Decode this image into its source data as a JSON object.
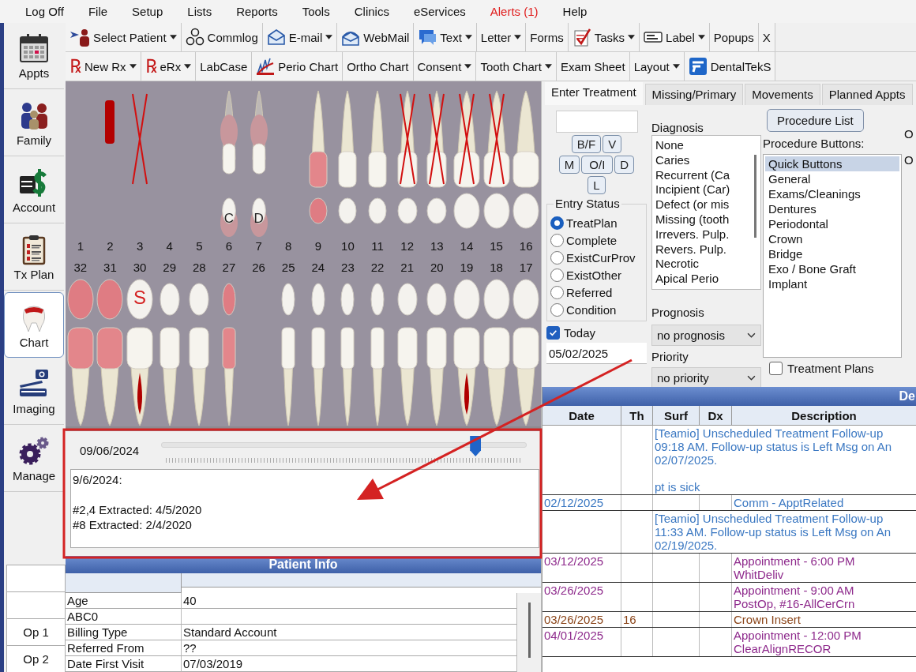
{
  "menu": [
    {
      "label": "Log Off",
      "alert": false
    },
    {
      "label": "File",
      "alert": false
    },
    {
      "label": "Setup",
      "alert": false
    },
    {
      "label": "Lists",
      "alert": false
    },
    {
      "label": "Reports",
      "alert": false
    },
    {
      "label": "Tools",
      "alert": false
    },
    {
      "label": "Clinics",
      "alert": false
    },
    {
      "label": "eServices",
      "alert": false
    },
    {
      "label": "Alerts (1)",
      "alert": true
    },
    {
      "label": "Help",
      "alert": false
    }
  ],
  "sidebar": {
    "items": [
      {
        "label": "Appts",
        "selected": false
      },
      {
        "label": "Family",
        "selected": false
      },
      {
        "label": "Account",
        "selected": false
      },
      {
        "label": "Tx Plan",
        "selected": false
      },
      {
        "label": "Chart",
        "selected": true
      },
      {
        "label": "Imaging",
        "selected": false
      },
      {
        "label": "Manage",
        "selected": false
      }
    ]
  },
  "op_list": [
    "Op 1",
    "Op 2"
  ],
  "toolbar_1": {
    "buttons": [
      {
        "label": "Select Patient",
        "kind": "patient",
        "dropdown": true
      },
      {
        "label": "Commlog",
        "kind": "commlog",
        "dropdown": false
      },
      {
        "label": "E-mail",
        "kind": "email",
        "dropdown": true
      },
      {
        "label": "WebMail",
        "kind": "webmail",
        "dropdown": false
      },
      {
        "label": "Text",
        "kind": "text",
        "dropdown": true
      },
      {
        "label": "Letter",
        "kind": "plain",
        "dropdown": true
      },
      {
        "label": "Forms",
        "kind": "plain",
        "dropdown": false
      },
      {
        "label": "Tasks",
        "kind": "tasks",
        "dropdown": true
      },
      {
        "label": "Label",
        "kind": "label",
        "dropdown": true
      },
      {
        "label": "Popups",
        "kind": "plain",
        "dropdown": false
      },
      {
        "label": "X",
        "kind": "plain",
        "dropdown": false
      }
    ]
  },
  "toolbar_2": {
    "buttons": [
      {
        "label": "New Rx",
        "kind": "rx",
        "icon_text": "℞",
        "dropdown": true
      },
      {
        "label": "eRx",
        "kind": "rx",
        "icon_text": "℞",
        "dropdown": true
      },
      {
        "label": "LabCase",
        "kind": "plain",
        "dropdown": false
      },
      {
        "label": "Perio Chart",
        "kind": "perio",
        "dropdown": false
      },
      {
        "label": "Ortho Chart",
        "kind": "plain",
        "dropdown": false
      },
      {
        "label": "Consent",
        "kind": "plain",
        "dropdown": true
      },
      {
        "label": "Tooth Chart",
        "kind": "plain",
        "dropdown": true
      },
      {
        "label": "Exam Sheet",
        "kind": "plain",
        "dropdown": false
      },
      {
        "label": "Layout",
        "kind": "plain",
        "dropdown": true
      },
      {
        "label": "DentalTekS",
        "kind": "dentaltek",
        "dropdown": false
      }
    ]
  },
  "upper_teeth": [
    {
      "number": "1",
      "present": false
    },
    {
      "number": "2",
      "present": false,
      "implant": true
    },
    {
      "number": "3",
      "present": false,
      "crossed": true
    },
    {
      "number": "4",
      "present": false
    },
    {
      "number": "5",
      "present": false
    },
    {
      "number": "6",
      "present": true,
      "primary": true,
      "mark": "C"
    },
    {
      "number": "7",
      "present": true,
      "primary": true,
      "mark": "D"
    },
    {
      "number": "8",
      "present": false
    },
    {
      "number": "9",
      "present": true,
      "crown": true
    },
    {
      "number": "10",
      "present": true
    },
    {
      "number": "11",
      "present": true
    },
    {
      "number": "12",
      "present": true,
      "crossed": true
    },
    {
      "number": "13",
      "present": true,
      "crossed": true
    },
    {
      "number": "14",
      "present": true,
      "crossed": true
    },
    {
      "number": "15",
      "present": true,
      "crossed": true
    },
    {
      "number": "16",
      "present": true
    }
  ],
  "lower_teeth": [
    {
      "number": "32",
      "present": true,
      "crown": true
    },
    {
      "number": "31",
      "present": true,
      "crown": true
    },
    {
      "number": "30",
      "present": true,
      "root_canal": true,
      "mark": "S"
    },
    {
      "number": "29",
      "present": true
    },
    {
      "number": "28",
      "present": true
    },
    {
      "number": "27",
      "present": true,
      "crown": true
    },
    {
      "number": "26",
      "present": false
    },
    {
      "number": "25",
      "present": true
    },
    {
      "number": "24",
      "present": true
    },
    {
      "number": "23",
      "present": true
    },
    {
      "number": "22",
      "present": true
    },
    {
      "number": "21",
      "present": true
    },
    {
      "number": "20",
      "present": true
    },
    {
      "number": "19",
      "present": true,
      "root_canal": true
    },
    {
      "number": "18",
      "present": true
    },
    {
      "number": "17",
      "present": true
    }
  ],
  "note_history": {
    "date": "09/06/2024",
    "level": 0.86
  },
  "note": {
    "value": "9/6/2024:\n\n#2,4 Extracted: 4/5/2020\n#8 Extracted: 2/4/2020"
  },
  "patient_info": {
    "title": "Patient Info",
    "rows": [
      {
        "label": "Age",
        "value": "40"
      },
      {
        "label": "ABC0"
      },
      {
        "label": "Billing Type",
        "value": "Standard Account"
      },
      {
        "label": "Referred From",
        "value": "??"
      },
      {
        "label": "Date First Visit",
        "value": "07/03/2019"
      }
    ]
  },
  "treatment": {
    "tabs": [
      {
        "label": "Enter Treatment",
        "selected": true
      },
      {
        "label": "Missing/Primary",
        "selected": false
      },
      {
        "label": "Movements",
        "selected": false
      },
      {
        "label": "Planned Appts",
        "selected": false
      }
    ],
    "surface_buttons": [
      "B/F",
      "V",
      "M",
      "O/I",
      "D",
      "L"
    ],
    "entry_status": {
      "title": "Entry Status",
      "options": [
        {
          "label": "TreatPlan",
          "selected": true
        },
        {
          "label": "Complete",
          "selected": false
        },
        {
          "label": "ExistCurProv",
          "selected": false
        },
        {
          "label": "ExistOther",
          "selected": false
        },
        {
          "label": "Referred",
          "selected": false
        },
        {
          "label": "Condition",
          "selected": false
        }
      ]
    },
    "today": {
      "label": "Today",
      "checked": true
    },
    "date_field": {
      "value": "05/02/2025"
    },
    "diagnosis": {
      "label": "Diagnosis",
      "items": [
        "None",
        "Caries",
        "Recurrent (Ca",
        "Incipient (Car)",
        "Defect (or mis",
        "Missing (tooth",
        "Irrevers. Pulp.",
        "Revers. Pulp.",
        "Necrotic",
        "Apical Perio"
      ]
    },
    "prognosis": {
      "label": "Prognosis",
      "value": "no prognosis"
    },
    "priority": {
      "label": "Priority",
      "value": "no priority"
    },
    "procedure_list_button": "Procedure List",
    "procedure_buttons": {
      "label": "Procedure Buttons:",
      "items": [
        {
          "label": "Quick Buttons",
          "selected": true
        },
        {
          "label": "General",
          "selected": false
        },
        {
          "label": "Exams/Cleanings",
          "selected": false
        },
        {
          "label": "Dentures",
          "selected": false
        },
        {
          "label": "Periodontal",
          "selected": false
        },
        {
          "label": "Crown",
          "selected": false
        },
        {
          "label": "Bridge",
          "selected": false
        },
        {
          "label": "Exo / Bone Graft",
          "selected": false
        },
        {
          "label": "Implant",
          "selected": false
        }
      ]
    },
    "treatment_plans": {
      "label": "Treatment Plans",
      "checked": false
    },
    "column_4": [
      "O",
      "O"
    ]
  },
  "progress_notes": {
    "title": "De",
    "columns": [
      "Date",
      "Th",
      "Surf",
      "Dx",
      "Description"
    ],
    "rows": [
      {
        "kind": "note",
        "color": "#3b78c2",
        "text": "[Teamio] Unscheduled Treatment Follow-up\n09:18 AM. Follow-up status is Left Msg on An\n02/07/2025.\n\npt is sick"
      },
      {
        "kind": "entry",
        "color": "#3b78c2",
        "date": "02/12/2025",
        "description": "Comm - ApptRelated"
      },
      {
        "kind": "note",
        "color": "#3b78c2",
        "text": "[Teamio] Unscheduled Treatment Follow-up\n11:33 AM. Follow-up status is Left Msg on An\n02/19/2025."
      },
      {
        "kind": "entry",
        "color": "#8e2a8c",
        "date": "03/12/2025",
        "description": "Appointment - 6:00 PM\nWhitDeliv"
      },
      {
        "kind": "entry",
        "color": "#8e2a8c",
        "date": "03/26/2025",
        "description": "Appointment - 9:00 AM\nPostOp, #16-AllCerCrn"
      },
      {
        "kind": "entry",
        "color": "#8a4418",
        "date": "03/26/2025",
        "tooth": "16",
        "description": "Crown Insert"
      },
      {
        "kind": "entry",
        "color": "#8e2a8c",
        "date": "04/01/2025",
        "description": "Appointment - 12:00 PM\nClearAlignRECOR"
      }
    ]
  },
  "annotation": {
    "arrow": true,
    "frame": true
  }
}
